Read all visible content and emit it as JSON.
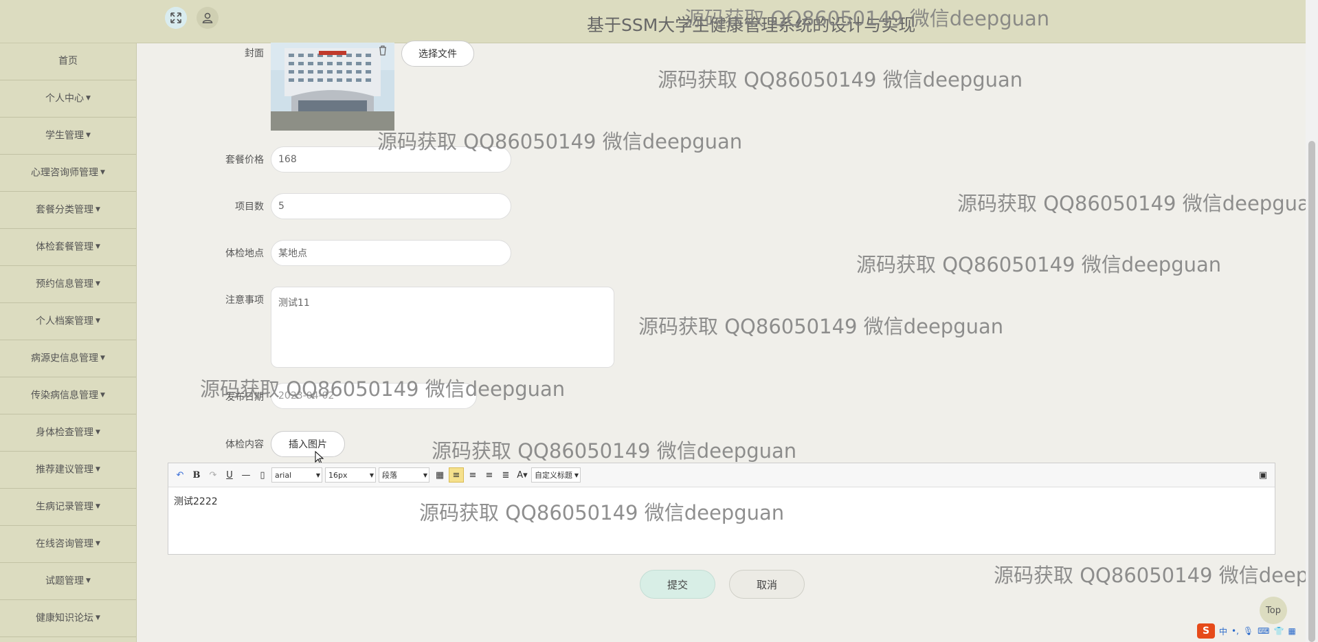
{
  "header": {
    "title": "基于SSM大学生健康管理系统的设计与实现"
  },
  "sidebar": {
    "items": [
      {
        "label": "首页"
      },
      {
        "label": "个人中心"
      },
      {
        "label": "学生管理"
      },
      {
        "label": "心理咨询师管理"
      },
      {
        "label": "套餐分类管理"
      },
      {
        "label": "体检套餐管理"
      },
      {
        "label": "预约信息管理"
      },
      {
        "label": "个人档案管理"
      },
      {
        "label": "病源史信息管理"
      },
      {
        "label": "传染病信息管理"
      },
      {
        "label": "身体检查管理"
      },
      {
        "label": "推荐建议管理"
      },
      {
        "label": "生病记录管理"
      },
      {
        "label": "在线咨询管理"
      },
      {
        "label": "试题管理"
      },
      {
        "label": "健康知识论坛"
      }
    ]
  },
  "form": {
    "cover_label": "封面",
    "choose_file": "选择文件",
    "price_label": "套餐价格",
    "price_value": "168",
    "items_label": "项目数",
    "items_value": "5",
    "location_label": "体检地点",
    "location_value": "某地点",
    "notes_label": "注意事项",
    "notes_value": "测试11",
    "date_label": "发布日期",
    "date_value": "2023-04-02",
    "content_label": "体检内容",
    "insert_image": "插入图片",
    "editor": {
      "font": "arial",
      "size": "16px",
      "paragraph": "段落",
      "custom_title": "自定义标题",
      "content": "测试2222"
    },
    "submit": "提交",
    "cancel": "取消"
  },
  "top_button": "Top",
  "watermark": "源码获取 QQ86050149 微信deepguan",
  "ime": {
    "lang": "中"
  }
}
